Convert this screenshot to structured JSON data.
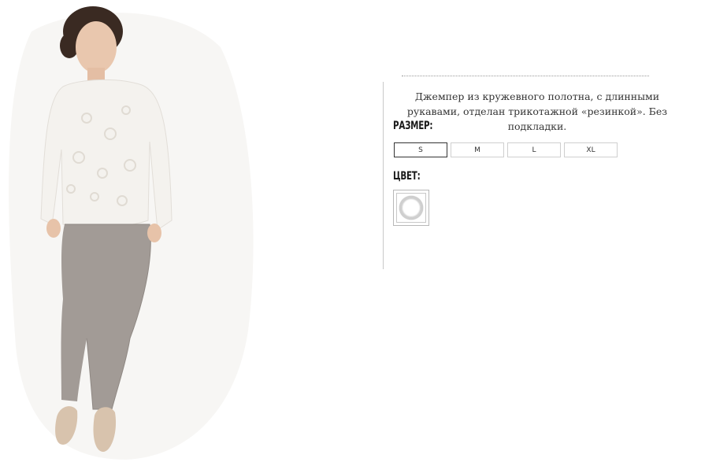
{
  "product": {
    "photo_icon": "model-photo-lace-jumper",
    "description": "Джемпер из кружевного полотна, с длинными рукавами, отделан трикотажной «резинкой». Без подкладки.",
    "size_label": "РАЗМЕР:",
    "sizes": [
      "S",
      "M",
      "L",
      "XL"
    ],
    "selected_size": "S",
    "color_label": "ЦВЕТ:",
    "color_swatch": "#ffffff"
  }
}
